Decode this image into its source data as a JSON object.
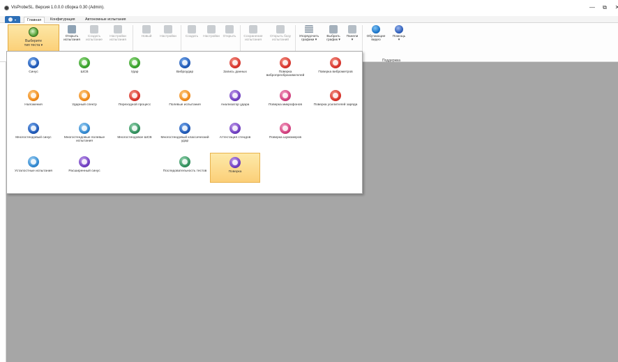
{
  "window": {
    "title": "VisProbeSL. Версия 1.0.0.0 сборка 0.30 (Admin).",
    "minimize_glyph": "—",
    "maximize_glyph": "⧉",
    "close_glyph": "✕"
  },
  "tabs": [
    {
      "label": "Главная",
      "active": true
    },
    {
      "label": "Конфигурация",
      "active": false
    },
    {
      "label": "Автономные испытания",
      "active": false
    }
  ],
  "ribbon": {
    "main_button": {
      "line1": "Выберите",
      "line2": "тип теста ▾"
    },
    "buttons": [
      {
        "line1": "Открыть",
        "line2": "испытания"
      },
      {
        "line1": "Создать",
        "line2": "испытание"
      },
      {
        "line1": "Настройки",
        "line2": "испытания"
      },
      {
        "line1": "Новый",
        "line2": ""
      },
      {
        "line1": "Настройки",
        "line2": ""
      },
      {
        "line1": "Создать",
        "line2": ""
      },
      {
        "line1": "Настройки",
        "line2": ""
      },
      {
        "line1": "Открыть",
        "line2": ""
      },
      {
        "line1": "Сохранение",
        "line2": "испытания"
      },
      {
        "line1": "Открыть базу",
        "line2": "испытаний"
      },
      {
        "line1": "Упорядочить",
        "line2": "графики ▾"
      },
      {
        "line1": "Выбрать",
        "line2": "график ▾"
      },
      {
        "line1": "Панели",
        "line2": "▾"
      },
      {
        "line1": "Обучающие",
        "line2": "видео"
      },
      {
        "line1": "Помощь",
        "line2": "▾"
      }
    ],
    "support_group_caption": "Поддержка"
  },
  "gallery": {
    "items": [
      {
        "label": "Синус",
        "color": "#1e57b5"
      },
      {
        "label": "ШСВ",
        "color": "#36a02a"
      },
      {
        "label": "Удар",
        "color": "#36a02a"
      },
      {
        "label": "Виброудар",
        "color": "#1e57b5"
      },
      {
        "label": "Запись данных",
        "color": "#d8322a"
      },
      {
        "label": "Поверка вибропреобразователей",
        "color": "#d8322a"
      },
      {
        "label": "Поверка виброметров",
        "color": "#d8322a"
      },
      {
        "label": "Наложения",
        "color": "#f08a19"
      },
      {
        "label": "Ударный спектр",
        "color": "#f08a19"
      },
      {
        "label": "Переходной процесс",
        "color": "#d8322a"
      },
      {
        "label": "Полевые испытания",
        "color": "#f08a19"
      },
      {
        "label": "Анализатор удара",
        "color": "#6d3cc0"
      },
      {
        "label": "Поверка микрофонов",
        "color": "#d23e7d"
      },
      {
        "label": "Поверка усилителей заряда",
        "color": "#d8322a"
      },
      {
        "label": "Многостендовый синус",
        "color": "#1e57b5"
      },
      {
        "label": "Многостендовые полевые испытания",
        "color": "#2e86cf"
      },
      {
        "label": "Многостендовое ШСВ",
        "color": "#2f8e5b"
      },
      {
        "label": "Многостендовый классический удар",
        "color": "#1e57b5"
      },
      {
        "label": "Аттестация стендов",
        "color": "#6d3cc0"
      },
      {
        "label": "Поверка шумомеров",
        "color": "#d23e7d"
      },
      {
        "label": "Усталостные испытания",
        "color": "#2e86cf"
      },
      {
        "label": "Расширенный синус",
        "color": "#6d3cc0"
      },
      {
        "label": "Последовательность тестов",
        "color": "#2f8e5b"
      },
      {
        "label": "Поверка",
        "color": "#6d3cc0",
        "selected": true
      }
    ]
  }
}
